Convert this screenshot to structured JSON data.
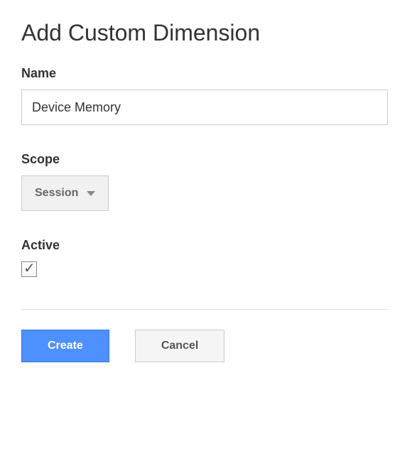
{
  "title": "Add Custom Dimension",
  "fields": {
    "name": {
      "label": "Name",
      "value": "Device Memory"
    },
    "scope": {
      "label": "Scope",
      "selected": "Session"
    },
    "active": {
      "label": "Active",
      "checked": true
    }
  },
  "buttons": {
    "create": "Create",
    "cancel": "Cancel"
  }
}
